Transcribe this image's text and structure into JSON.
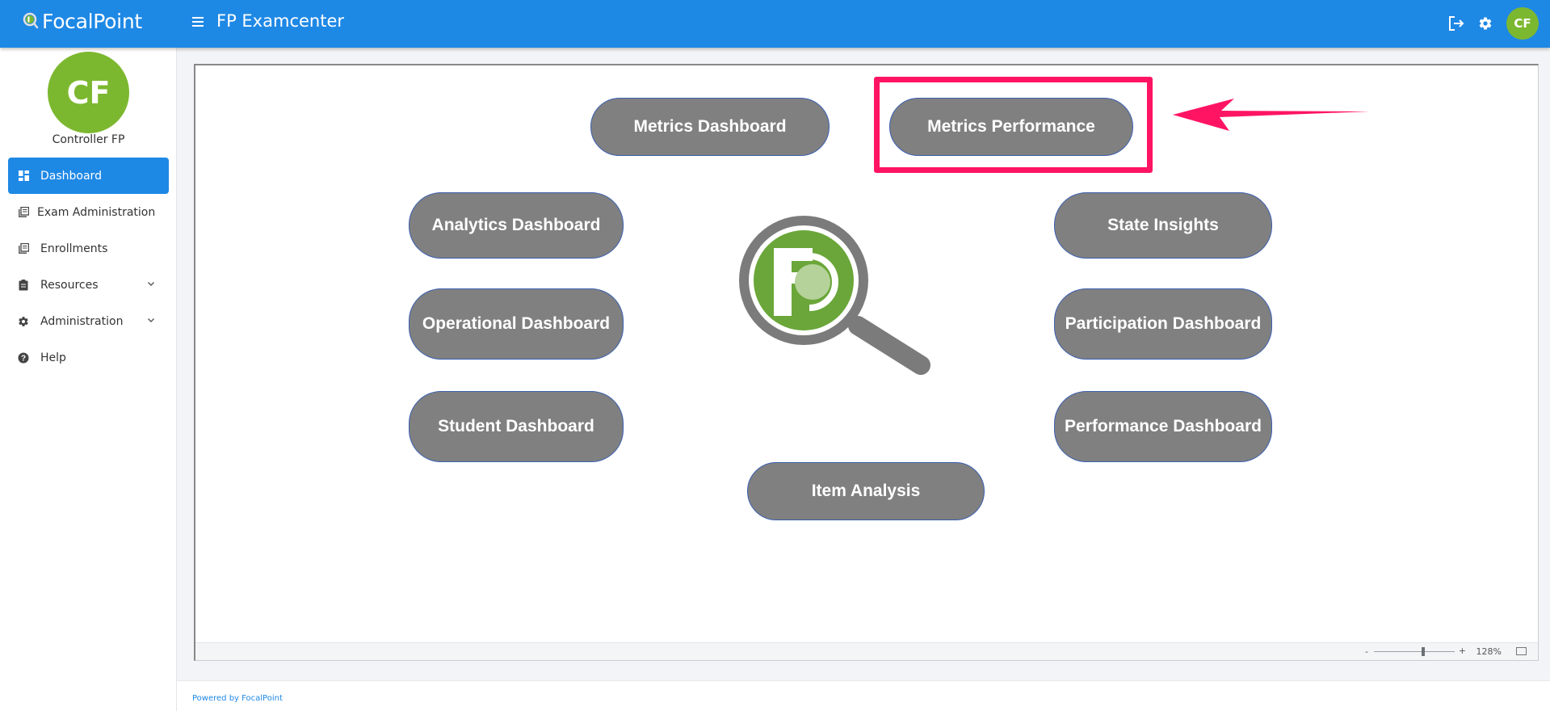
{
  "header": {
    "brand": "FocalPoint",
    "app_title": "FP Examcenter",
    "avatar_initials": "CF",
    "accent_color": "#1e88e5"
  },
  "sidebar": {
    "avatar_initials": "CF",
    "user_name": "Controller FP",
    "items": [
      {
        "label": "Dashboard",
        "icon": "dashboard-icon",
        "active": true
      },
      {
        "label": "Exam Administration",
        "icon": "library-books-icon"
      },
      {
        "label": "Enrollments",
        "icon": "library-books-icon"
      },
      {
        "label": "Resources",
        "icon": "clipboard-icon",
        "expandable": true
      },
      {
        "label": "Administration",
        "icon": "gear-icon",
        "expandable": true
      },
      {
        "label": "Help",
        "icon": "help-circle-icon"
      }
    ]
  },
  "main": {
    "buttons": {
      "metrics_dashboard": "Metrics Dashboard",
      "metrics_performance": "Metrics Performance",
      "analytics_dashboard": "Analytics Dashboard",
      "state_insights": "State Insights",
      "operational_dashboard": "Operational Dashboard",
      "participation_dashboard": "Participation Dashboard",
      "student_dashboard": "Student Dashboard",
      "performance_dashboard": "Performance Dashboard",
      "item_analysis": "Item Analysis"
    },
    "highlight_color": "#ff1463",
    "viewer": {
      "zoom_minus": "-",
      "zoom_plus": "+",
      "zoom_level": "128%"
    }
  },
  "footer": {
    "text": "Powered by FocalPoint"
  }
}
